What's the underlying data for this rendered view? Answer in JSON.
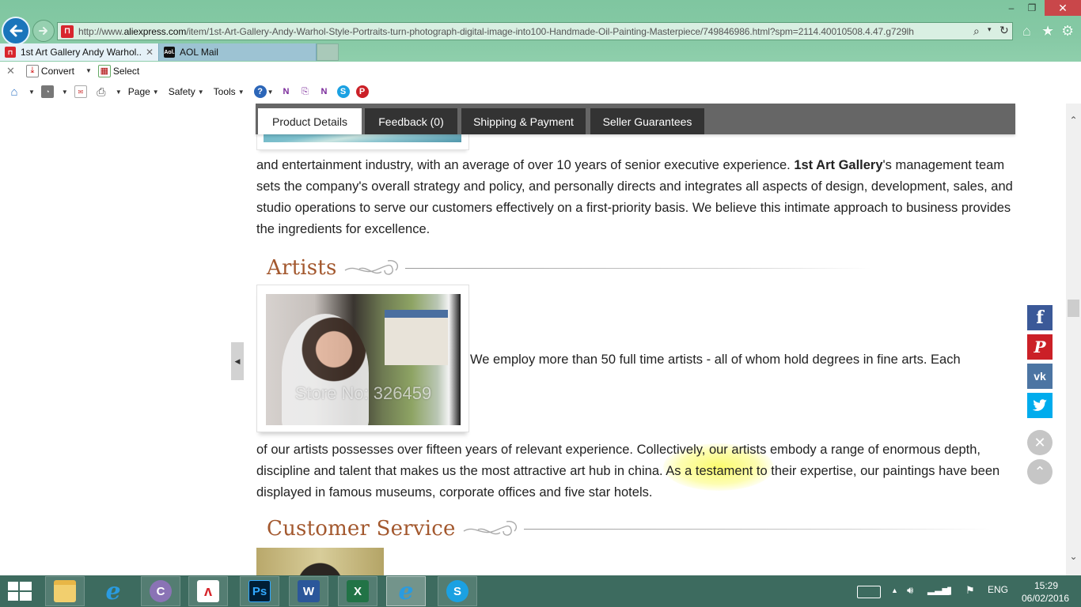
{
  "browser": {
    "url_prefix": "http://www.",
    "url_domain": "aliexpress.com",
    "url_rest": "/item/1st-Art-Gallery-Andy-Warhol-Style-Portraits-turn-photograph-digital-image-into100-Handmade-Oil-Painting-Masterpiece/749846986.html?spm=2114.40010508.4.47.g729lh",
    "window_controls": {
      "minimize": "–",
      "maximize": "❐",
      "close": "✕"
    },
    "tabs": [
      {
        "label": "1st Art Gallery Andy Warhol...",
        "icon": "aliexpress-favicon",
        "active": true
      },
      {
        "label": "AOL Mail",
        "icon": "aol-favicon",
        "active": false
      }
    ],
    "command_bar_1": {
      "convert_label": "Convert",
      "select_label": "Select"
    },
    "command_bar_2": {
      "page_label": "Page",
      "safety_label": "Safety",
      "tools_label": "Tools"
    }
  },
  "product_tabs": [
    {
      "label": "Product Details",
      "active": true
    },
    {
      "label": "Feedback (0)",
      "active": false
    },
    {
      "label": "Shipping & Payment",
      "active": false
    },
    {
      "label": "Seller Guarantees",
      "active": false
    }
  ],
  "content": {
    "para1_a": "and entertainment industry, with an average of over 10 years of senior executive experience. ",
    "para1_bold": "1st Art Gallery",
    "para1_b": "'s management team sets the company's overall strategy and policy, and personally directs and integrates all aspects of design, development, sales, and studio operations to serve our customers effectively on a first-priority basis. We believe this intimate approach to business provides the ingredients for excellence.",
    "artists_title": "Artists",
    "artist_image_watermark": "Store No: 326459",
    "para2_inline": "We employ more than 50 full time artists - all of whom hold degrees in fine arts. Each",
    "para2_rest": "of our artists possesses over fifteen years of relevant experience. Collectively, our artists embody a range of enormous depth, discipline and talent that makes us the most attractive art hub in china. As a testament to their expertise, our paintings have been displayed in famous museums, corporate offices and five star hotels.",
    "customer_service_title": "Customer Service"
  },
  "share": {
    "facebook": "f",
    "pinterest": "P",
    "vk": "vk",
    "twitter": "t",
    "close": "✕",
    "back_to_top": "⌃"
  },
  "taskbar": {
    "apps": [
      "file-explorer",
      "internet-explorer",
      "bittorrent",
      "adobe-reader",
      "photoshop",
      "word",
      "excel",
      "internet-explorer",
      "skype"
    ],
    "ps_label": "Ps",
    "word_label": "W",
    "excel_label": "X",
    "skype_label": "S",
    "language": "ENG",
    "time": "15:29",
    "date": "06/02/2016"
  }
}
